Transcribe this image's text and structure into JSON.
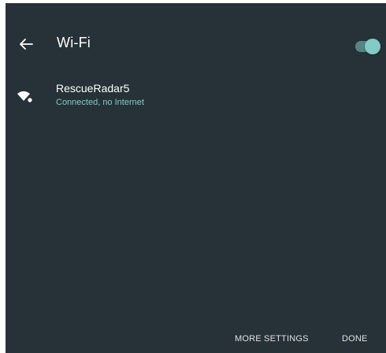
{
  "header": {
    "title": "Wi-Fi",
    "back_icon": "arrow-back-icon",
    "toggle": {
      "state": "on",
      "thumb_color": "#80cbc4",
      "track_color": "#80cbc4"
    }
  },
  "networks": [
    {
      "name": "RescueRadar5",
      "status": "Connected, no Internet",
      "status_color": "#80cbc4",
      "icon": "wifi-no-internet-icon"
    }
  ],
  "footer": {
    "more_settings_label": "MORE SETTINGS",
    "done_label": "DONE"
  },
  "colors": {
    "background": "#263238",
    "accent": "#80cbc4",
    "text_primary": "#ffffff"
  }
}
